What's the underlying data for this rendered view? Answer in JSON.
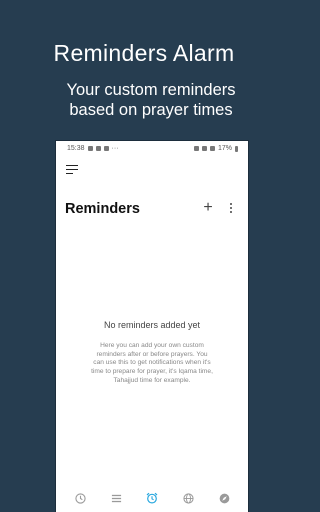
{
  "promo": {
    "title": "Reminders Alarm",
    "subtitle_lines": [
      "Your custom reminders",
      "based on prayer times"
    ]
  },
  "status_bar": {
    "time": "15:38",
    "dots": "···",
    "battery": "17%"
  },
  "app": {
    "title": "Reminders",
    "add_symbol": "+",
    "empty_title": "No reminders added yet",
    "empty_description_lines": [
      "Here you can add your own custom",
      "reminders after or before prayers. You",
      "can use this to get notifications when it's",
      "time to prepare for prayer, it's Iqama time,",
      "Tahajjud time for example."
    ]
  },
  "bottom_nav": [
    {
      "icon": "clock-icon"
    },
    {
      "icon": "list-icon"
    },
    {
      "icon": "alarm-icon",
      "active": true
    },
    {
      "icon": "globe-icon"
    },
    {
      "icon": "compass-icon"
    }
  ],
  "colors": {
    "background": "#263d50",
    "accent": "#29a8df",
    "inactive_icon": "#9a9a9a"
  }
}
